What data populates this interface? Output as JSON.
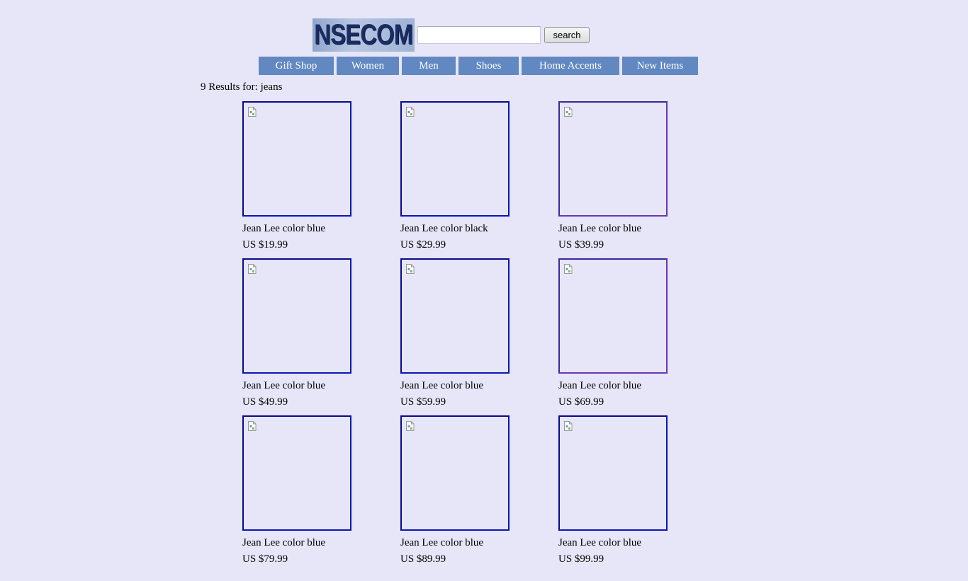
{
  "header": {
    "logo_text": "NSECOM",
    "search": {
      "value": "",
      "placeholder": ""
    },
    "search_button_label": "search"
  },
  "nav": {
    "items": [
      {
        "label": "Gift Shop"
      },
      {
        "label": "Women"
      },
      {
        "label": "Men"
      },
      {
        "label": "Shoes"
      },
      {
        "label": "Home Accents"
      },
      {
        "label": "New Items"
      }
    ]
  },
  "results": {
    "heading": "9 Results for: jeans",
    "products": [
      {
        "title": "Jean Lee color blue",
        "price": "US $19.99",
        "image_icon": "broken-image-icon"
      },
      {
        "title": "Jean Lee color black",
        "price": "US $29.99",
        "image_icon": "broken-image-icon"
      },
      {
        "title": "Jean Lee color blue",
        "price": "US $39.99",
        "image_icon": "broken-image-icon"
      },
      {
        "title": "Jean Lee color blue",
        "price": "US $49.99",
        "image_icon": "broken-image-icon"
      },
      {
        "title": "Jean Lee color blue",
        "price": "US $59.99",
        "image_icon": "broken-image-icon"
      },
      {
        "title": "Jean Lee color blue",
        "price": "US $69.99",
        "image_icon": "broken-image-icon"
      },
      {
        "title": "Jean Lee color blue",
        "price": "US $79.99",
        "image_icon": "broken-image-icon"
      },
      {
        "title": "Jean Lee color blue",
        "price": "US $89.99",
        "image_icon": "broken-image-icon"
      },
      {
        "title": "Jean Lee color blue",
        "price": "US $99.99",
        "image_icon": "broken-image-icon"
      }
    ]
  },
  "colors": {
    "background": "#e6e6f8",
    "nav_background": "#6288c2",
    "nav_text": "#ffffff",
    "image_border": "#0b16b8"
  }
}
